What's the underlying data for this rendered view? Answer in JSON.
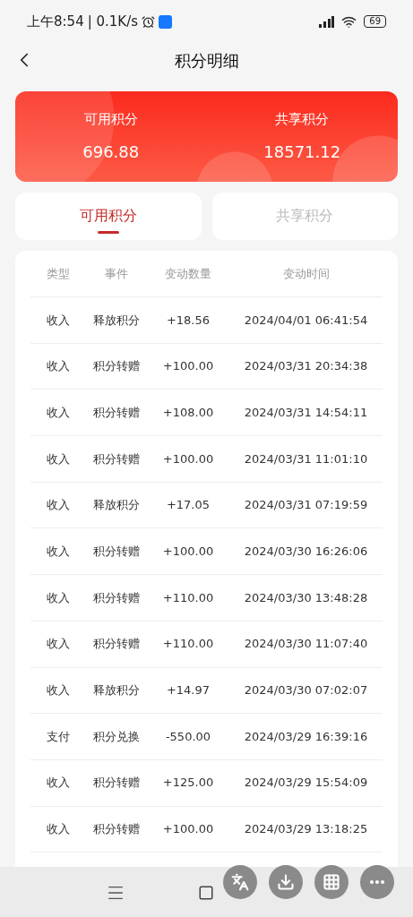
{
  "status_bar": {
    "time": "上午8:54",
    "speed": "| 0.1K/s",
    "battery": "69"
  },
  "header": {
    "title": "积分明细"
  },
  "summary": [
    {
      "label": "可用积分",
      "value": "696.88"
    },
    {
      "label": "共享积分",
      "value": "18571.12"
    }
  ],
  "tabs": [
    {
      "label": "可用积分",
      "selected": true
    },
    {
      "label": "共享积分",
      "selected": false
    }
  ],
  "table": {
    "columns": [
      "类型",
      "事件",
      "变动数量",
      "变动时间"
    ],
    "rows": [
      [
        "收入",
        "释放积分",
        "+18.56",
        "2024/04/01 06:41:54"
      ],
      [
        "收入",
        "积分转赠",
        "+100.00",
        "2024/03/31 20:34:38"
      ],
      [
        "收入",
        "积分转赠",
        "+108.00",
        "2024/03/31 14:54:11"
      ],
      [
        "收入",
        "积分转赠",
        "+100.00",
        "2024/03/31 11:01:10"
      ],
      [
        "收入",
        "释放积分",
        "+17.05",
        "2024/03/31 07:19:59"
      ],
      [
        "收入",
        "积分转赠",
        "+100.00",
        "2024/03/30 16:26:06"
      ],
      [
        "收入",
        "积分转赠",
        "+110.00",
        "2024/03/30 13:48:28"
      ],
      [
        "收入",
        "积分转赠",
        "+110.00",
        "2024/03/30 11:07:40"
      ],
      [
        "收入",
        "释放积分",
        "+14.97",
        "2024/03/30 07:02:07"
      ],
      [
        "支付",
        "积分兑换",
        "-550.00",
        "2024/03/29 16:39:16"
      ],
      [
        "收入",
        "积分转赠",
        "+125.00",
        "2024/03/29 15:54:09"
      ],
      [
        "收入",
        "积分转赠",
        "+100.00",
        "2024/03/29 13:18:25"
      ]
    ]
  },
  "floating_buttons": [
    {
      "kind": "translate"
    },
    {
      "kind": "download"
    },
    {
      "kind": "grid"
    },
    {
      "kind": "more"
    }
  ]
}
